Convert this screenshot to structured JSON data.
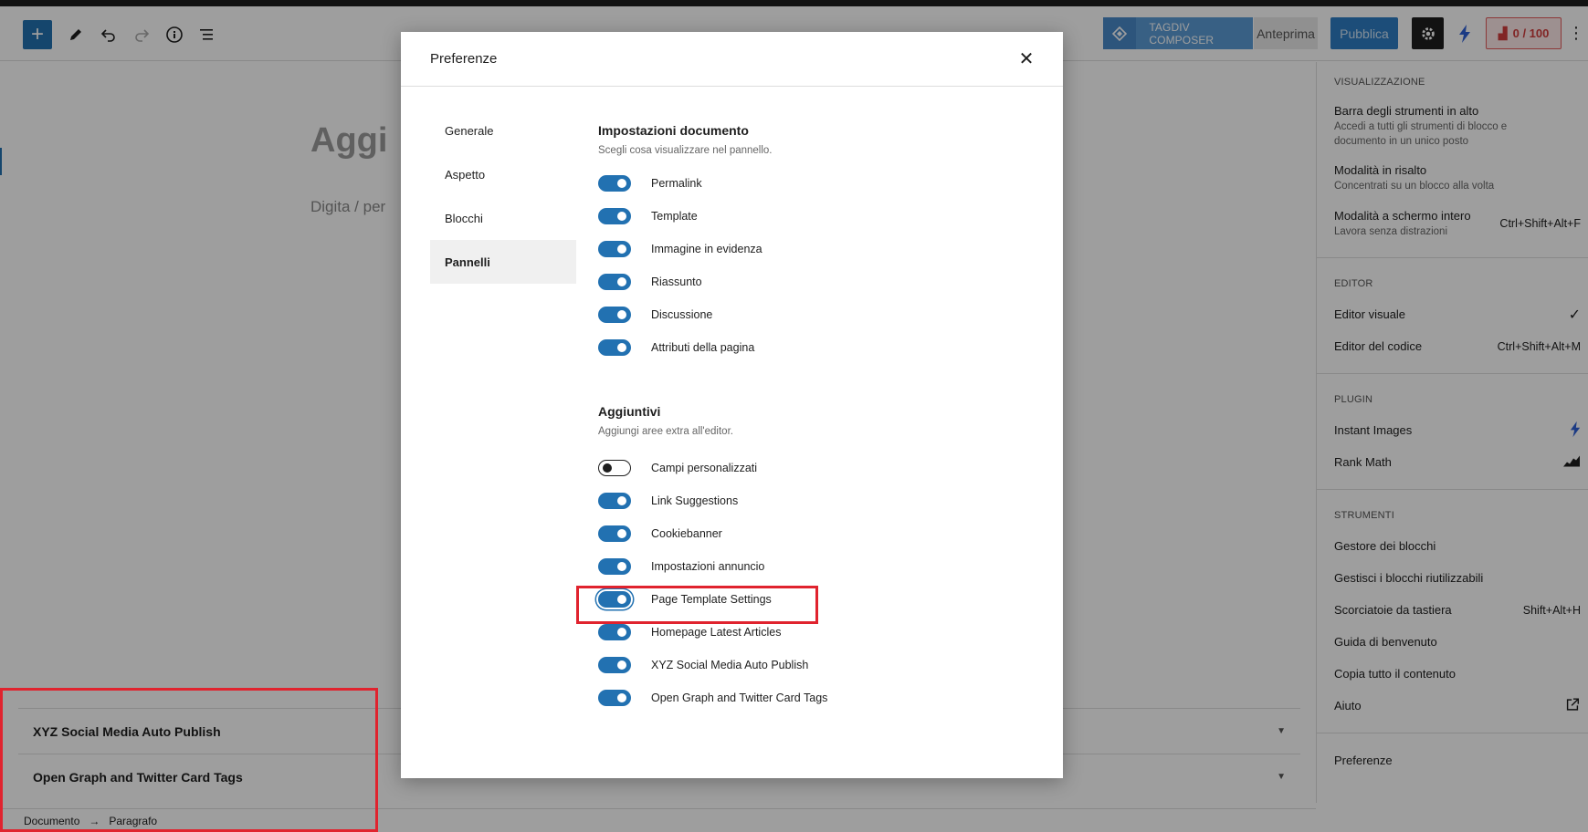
{
  "header": {
    "tagdiv_label": "TAGDIV COMPOSER",
    "preview_label": "Anteprima",
    "publish_label": "Pubblica",
    "score_label": "0 / 100"
  },
  "editor": {
    "title_placeholder": "Aggi",
    "paragraph_placeholder": "Digita / per",
    "meta_boxes": [
      "XYZ Social Media Auto Publish",
      "Open Graph and Twitter Card Tags"
    ],
    "breadcrumb": [
      "Documento",
      "Paragrafo"
    ]
  },
  "options_menu": {
    "groups": [
      {
        "heading": "VISUALIZZAZIONE",
        "items": [
          {
            "label": "Barra degli strumenti in alto",
            "desc": "Accedi a tutti gli strumenti di blocco e documento in un unico posto",
            "shortcut": ""
          },
          {
            "label": "Modalità in risalto",
            "desc": "Concentrati su un blocco alla volta",
            "shortcut": ""
          },
          {
            "label": "Modalità a schermo intero",
            "desc": "Lavora senza distrazioni",
            "shortcut": "Ctrl+Shift+Alt+F"
          }
        ]
      },
      {
        "heading": "EDITOR",
        "items": [
          {
            "label": "Editor visuale",
            "shortcut": "✓"
          },
          {
            "label": "Editor del codice",
            "shortcut": "Ctrl+Shift+Alt+M"
          }
        ]
      },
      {
        "heading": "PLUGIN",
        "items": [
          {
            "label": "Instant Images"
          },
          {
            "label": "Rank Math"
          }
        ]
      },
      {
        "heading": "STRUMENTI",
        "items": [
          {
            "label": "Gestore dei blocchi",
            "shortcut": ""
          },
          {
            "label": "Gestisci i blocchi riutilizzabili",
            "shortcut": ""
          },
          {
            "label": "Scorciatoie da tastiera",
            "shortcut": "Shift+Alt+H"
          },
          {
            "label": "Guida di benvenuto",
            "shortcut": ""
          },
          {
            "label": "Copia tutto il contenuto",
            "shortcut": ""
          },
          {
            "label": "Aiuto",
            "shortcut": ""
          }
        ]
      }
    ],
    "preferences_label": "Preferenze"
  },
  "modal": {
    "title": "Preferenze",
    "tabs": [
      "Generale",
      "Aspetto",
      "Blocchi",
      "Pannelli"
    ],
    "active_tab": "Pannelli",
    "document_section": {
      "title": "Impostazioni documento",
      "desc": "Scegli cosa visualizzare nel pannello.",
      "toggles": [
        {
          "label": "Permalink",
          "on": true
        },
        {
          "label": "Template",
          "on": true
        },
        {
          "label": "Immagine in evidenza",
          "on": true
        },
        {
          "label": "Riassunto",
          "on": true
        },
        {
          "label": "Discussione",
          "on": true
        },
        {
          "label": "Attributi della pagina",
          "on": true
        }
      ]
    },
    "extra_section": {
      "title": "Aggiuntivi",
      "desc": "Aggiungi aree extra all'editor.",
      "toggles": [
        {
          "label": "Campi personalizzati",
          "on": false
        },
        {
          "label": "Link Suggestions",
          "on": true
        },
        {
          "label": "Cookiebanner",
          "on": true
        },
        {
          "label": "Impostazioni annuncio",
          "on": true
        },
        {
          "label": "Page Template Settings",
          "on": true
        },
        {
          "label": "Homepage Latest Articles",
          "on": true
        },
        {
          "label": "XYZ Social Media Auto Publish",
          "on": true
        },
        {
          "label": "Open Graph and Twitter Card Tags",
          "on": true
        }
      ]
    }
  },
  "colors": {
    "accent": "#2271b1",
    "highlight": "#e0232e"
  }
}
